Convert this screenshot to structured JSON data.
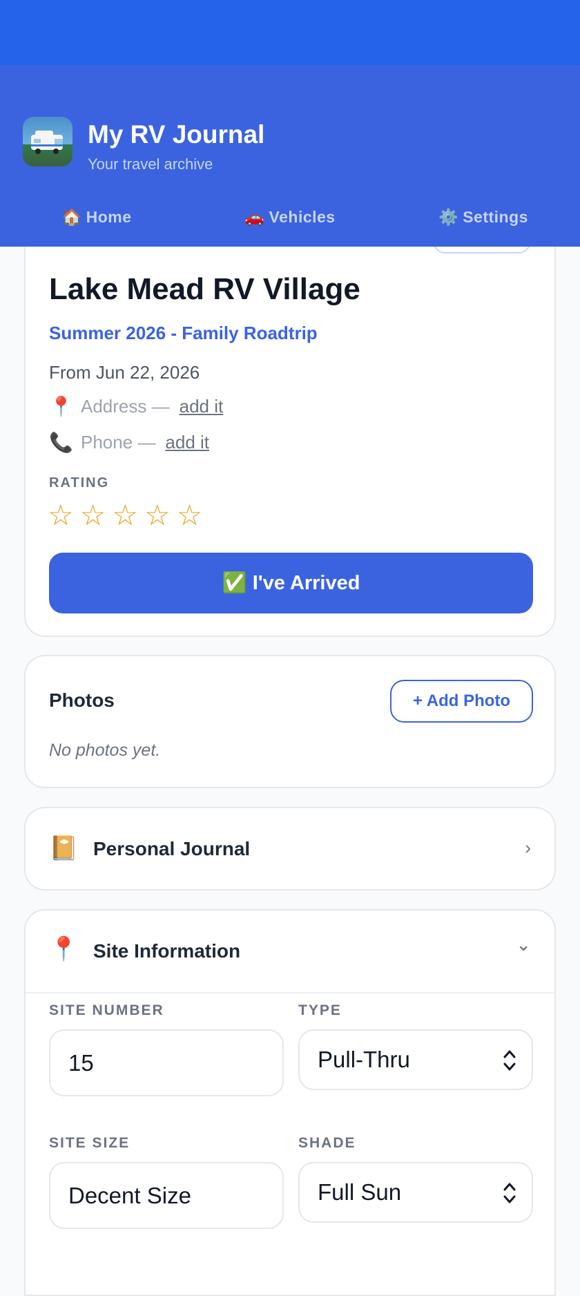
{
  "header": {
    "app_title": "My RV Journal",
    "app_subtitle": "Your travel archive",
    "nav": [
      {
        "emoji": "🏠",
        "label": "Home"
      },
      {
        "emoji": "🚗",
        "label": "Vehicles"
      },
      {
        "emoji": "⚙️",
        "label": "Settings"
      }
    ]
  },
  "stop": {
    "title": "Lake Mead RV Village",
    "trip": "Summer 2026 - Family Roadtrip",
    "dates": "From Jun 22, 2026",
    "address_label": "Address —",
    "address_link": "add it",
    "phone_label": "Phone —",
    "phone_link": "add it",
    "rating_label": "RATING",
    "rating_value": 0,
    "rating_max": 5,
    "arrive_button": "✅ I've Arrived"
  },
  "photos": {
    "title": "Photos",
    "add_button": "+ Add Photo",
    "empty_text": "No photos yet."
  },
  "journal": {
    "emoji": "📔",
    "title": "Personal Journal",
    "chevron": "›"
  },
  "site": {
    "emoji": "📍",
    "title": "Site Information",
    "chevron": "⌄",
    "site_number_label": "SITE NUMBER",
    "site_number_value": "15",
    "type_label": "TYPE",
    "type_value": "Pull-Thru",
    "size_label": "SITE SIZE",
    "size_value": "Decent Size",
    "shade_label": "SHADE",
    "shade_value": "Full Sun"
  },
  "icons": {
    "address": "📍",
    "phone": "📞",
    "star_empty": "☆",
    "app_icon": "rv-camper-icon"
  },
  "colors": {
    "primary": "#3b63e0",
    "status_bar": "#2563eb",
    "star": "#f0a020"
  }
}
